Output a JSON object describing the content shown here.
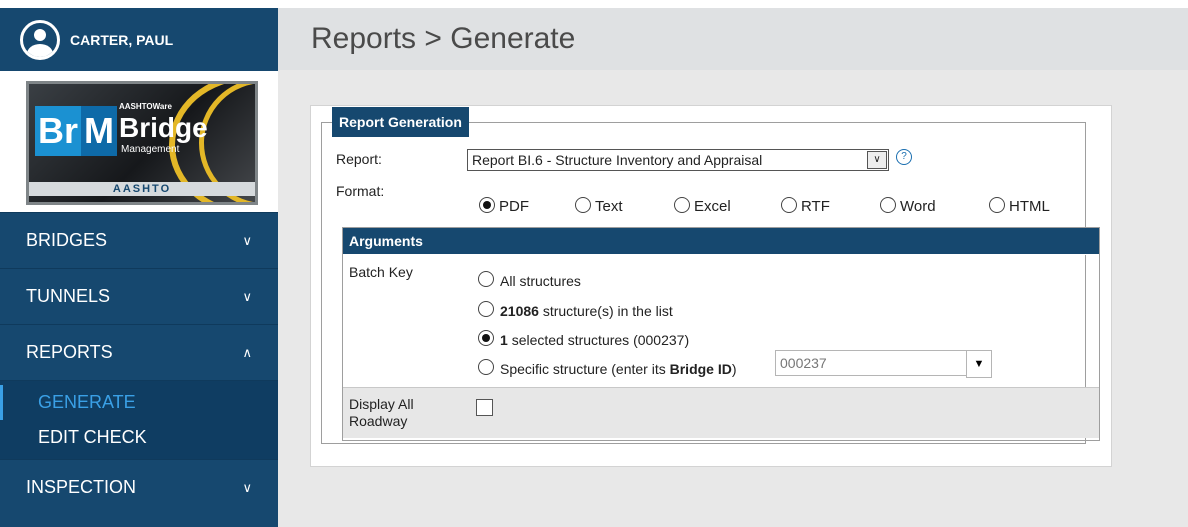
{
  "user": {
    "name": "CARTER, PAUL"
  },
  "logo": {
    "brand_top": "AASHTOWare",
    "brand_main": "Bridge",
    "brand_sub": "Management",
    "brm_b": "Br",
    "brm_m": "M",
    "aashto": "AASHTO"
  },
  "nav": {
    "bridges": "BRIDGES",
    "tunnels": "TUNNELS",
    "reports": "REPORTS",
    "reports_sub": [
      "GENERATE",
      "EDIT CHECK"
    ],
    "inspection": "INSPECTION"
  },
  "page": {
    "title": "Reports > Generate"
  },
  "report_generation": {
    "legend": "Report Generation",
    "report_label": "Report:",
    "report_value": "Report BI.6 - Structure Inventory and Appraisal",
    "help": "?",
    "format_label": "Format:",
    "formats": [
      "PDF",
      "Text",
      "Excel",
      "RTF",
      "Word",
      "HTML"
    ],
    "selected_format": "PDF"
  },
  "arguments": {
    "header": "Arguments",
    "batch_key_label": "Batch Key",
    "options": {
      "all": "All structures",
      "list_count": "21086",
      "list_text": "structure(s) in the list",
      "selected_count": "1",
      "selected_text": "selected structures (000237)",
      "specific_pre": "Specific structure (enter its",
      "specific_bold": "Bridge ID",
      "specific_post": ")"
    },
    "selected_option": "selected",
    "bridge_id_value": "000237",
    "display_all_label_1": "Display All",
    "display_all_label_2": "Roadway",
    "display_all_checked": false
  },
  "icons": {
    "chevron_down": "chevron-down-icon",
    "chevron_up": "chevron-up-icon",
    "help": "help-icon",
    "dropdown": "dropdown-arrow-icon"
  },
  "colors": {
    "sidebar": "#16486f",
    "active": "#3aa0e6",
    "header": "#16486f"
  }
}
